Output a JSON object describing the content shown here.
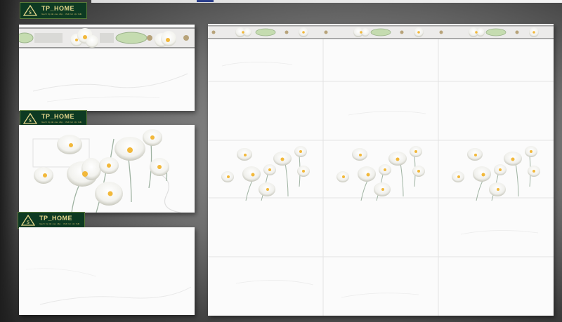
{
  "logo": {
    "brand": "TP_HOME",
    "tagline": "Gạch ốp lát cao cấp · thiết kế nội thất",
    "bg_color": "#0d3a22",
    "text_color": "#e6d88d"
  },
  "tiles": {
    "border_tile": "border-tile",
    "flower_tile": "flower-tile",
    "plain_tile": "plain-tile",
    "wall_preview": "wall-preview"
  },
  "colors": {
    "tile_white": "#fbfbfb",
    "leaf_green": "#c5dcb0",
    "petal_white": "#ffffff",
    "flower_center": "#f2b83a",
    "stem_green": "#9fb3a2"
  }
}
